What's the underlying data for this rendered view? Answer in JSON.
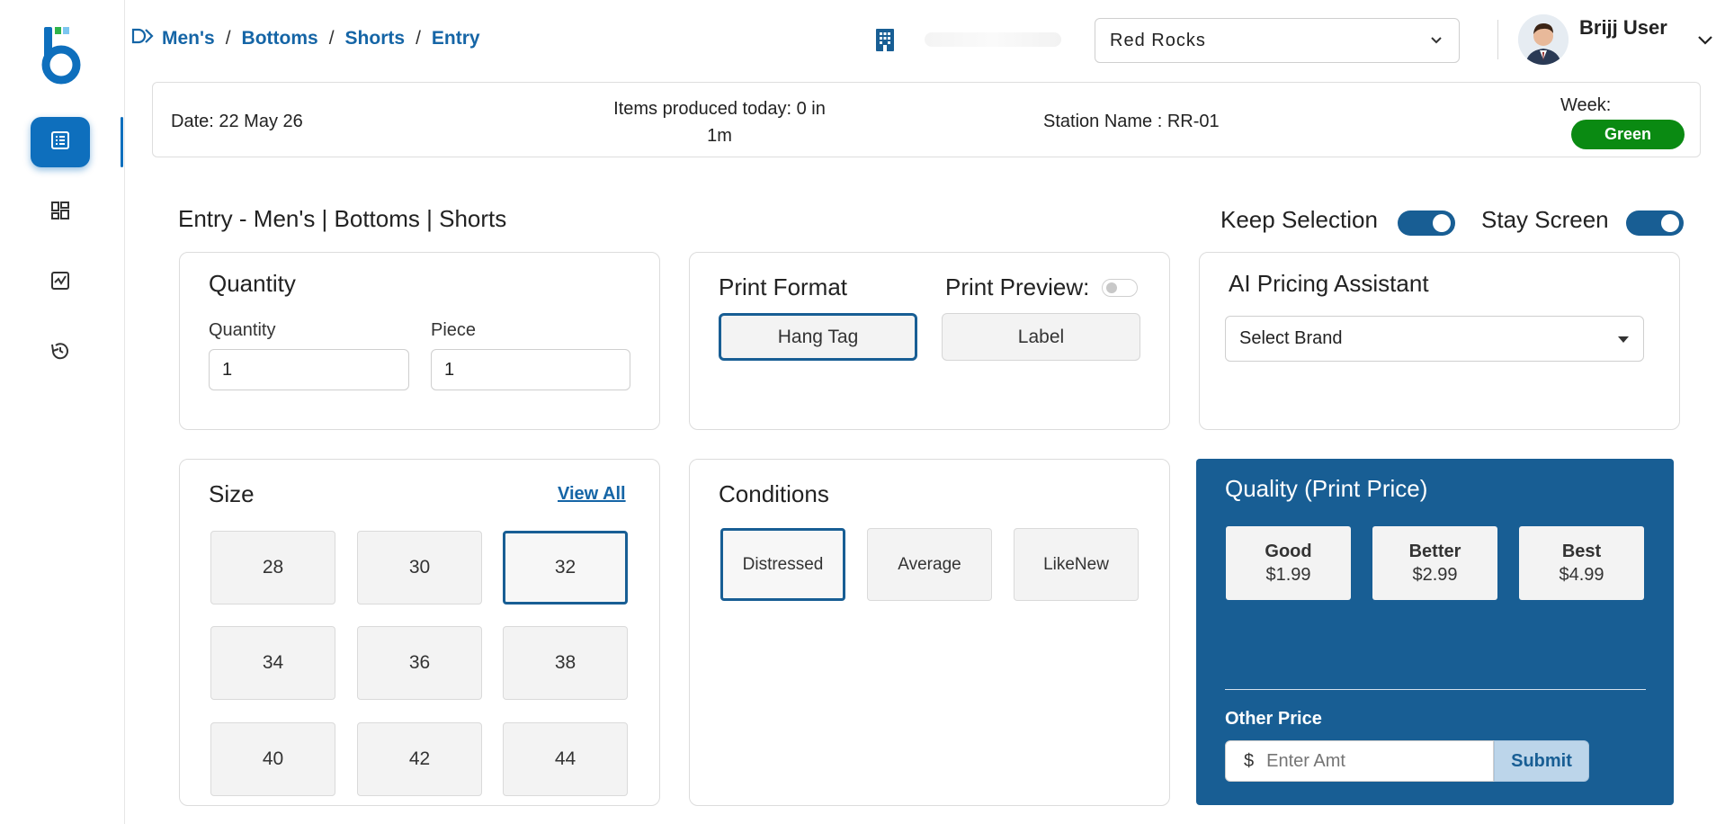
{
  "breadcrumb": {
    "items": [
      "Men's",
      "Bottoms",
      "Shorts",
      "Entry"
    ]
  },
  "header": {
    "store_selected": "Red Rocks",
    "user_name": "Brijj User"
  },
  "info": {
    "date": "Date: 22 May 26",
    "items_line1": "Items produced today: 0 in",
    "items_line2": "1m",
    "station": "Station Name : RR-01",
    "week_label": "Week:",
    "week_value": "Green"
  },
  "page": {
    "title": "Entry - Men's | Bottoms | Shorts",
    "keep_selection_label": "Keep Selection",
    "stay_screen_label": "Stay Screen"
  },
  "quantity_card": {
    "title": "Quantity",
    "quantity_label": "Quantity",
    "quantity_value": "1",
    "piece_label": "Piece",
    "piece_value": "1"
  },
  "print_card": {
    "title": "Print Format",
    "preview_label": "Print Preview:",
    "options": [
      "Hang Tag",
      "Label"
    ],
    "selected": "Hang Tag"
  },
  "ai_card": {
    "title": "AI Pricing Assistant",
    "brand_placeholder": "Select Brand"
  },
  "size_card": {
    "title": "Size",
    "view_all": "View All",
    "sizes": [
      "28",
      "30",
      "32",
      "34",
      "36",
      "38",
      "40",
      "42",
      "44"
    ],
    "selected": "32"
  },
  "conditions_card": {
    "title": "Conditions",
    "options": [
      "Distressed",
      "Average",
      "LikeNew"
    ],
    "selected": "Distressed"
  },
  "quality_card": {
    "title": "Quality (Print Price)",
    "options": [
      {
        "name": "Good",
        "price": "$1.99"
      },
      {
        "name": "Better",
        "price": "$2.99"
      },
      {
        "name": "Best",
        "price": "$4.99"
      }
    ],
    "other_price_label": "Other Price",
    "currency": "$",
    "amount_placeholder": "Enter Amt",
    "submit_label": "Submit"
  },
  "colors": {
    "primary": "#185e94",
    "link": "#1565a6",
    "nav_active": "#0e6fbd",
    "week_badge": "#0a8a12"
  }
}
